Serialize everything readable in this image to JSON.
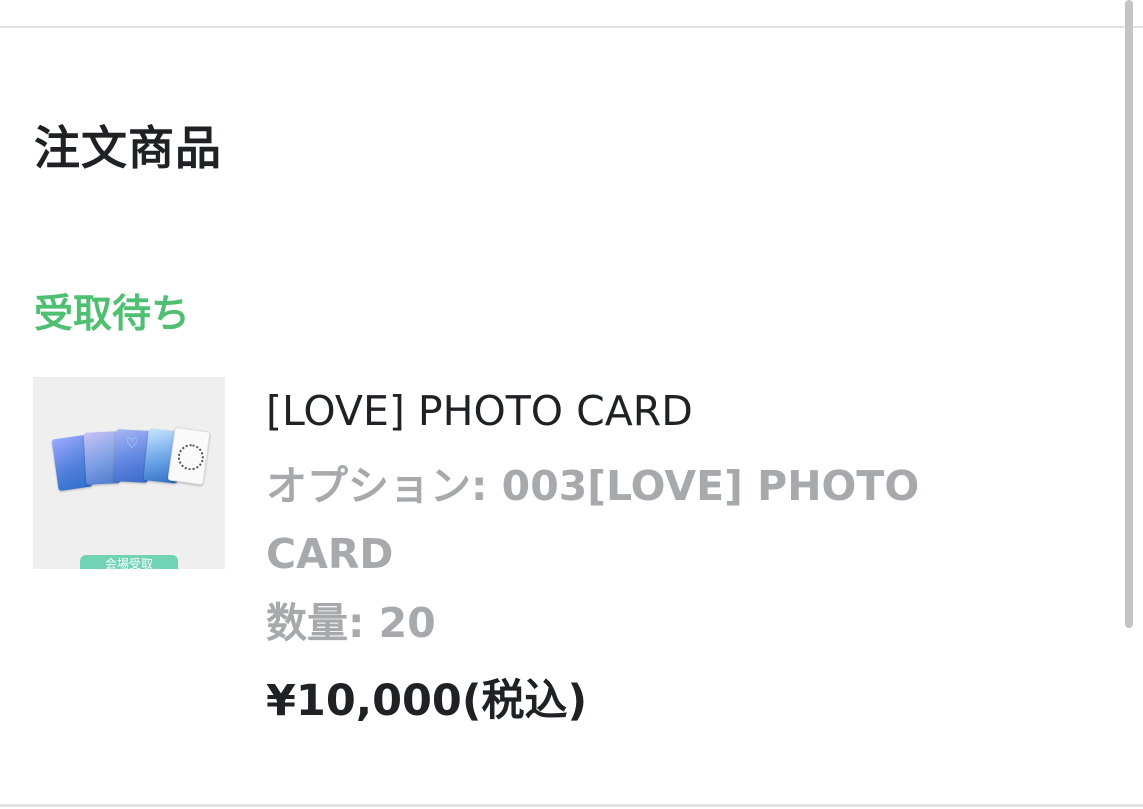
{
  "section": {
    "title": "注文商品"
  },
  "status": {
    "label": "受取待ち",
    "color": "#4fbf72"
  },
  "item": {
    "thumbnail_badge": "会場受取",
    "title": "[LOVE] PHOTO CARD",
    "option": "オプション: 003[LOVE] PHOTO CARD",
    "quantity": "数量: 20",
    "price": "¥10,000(税込)"
  }
}
